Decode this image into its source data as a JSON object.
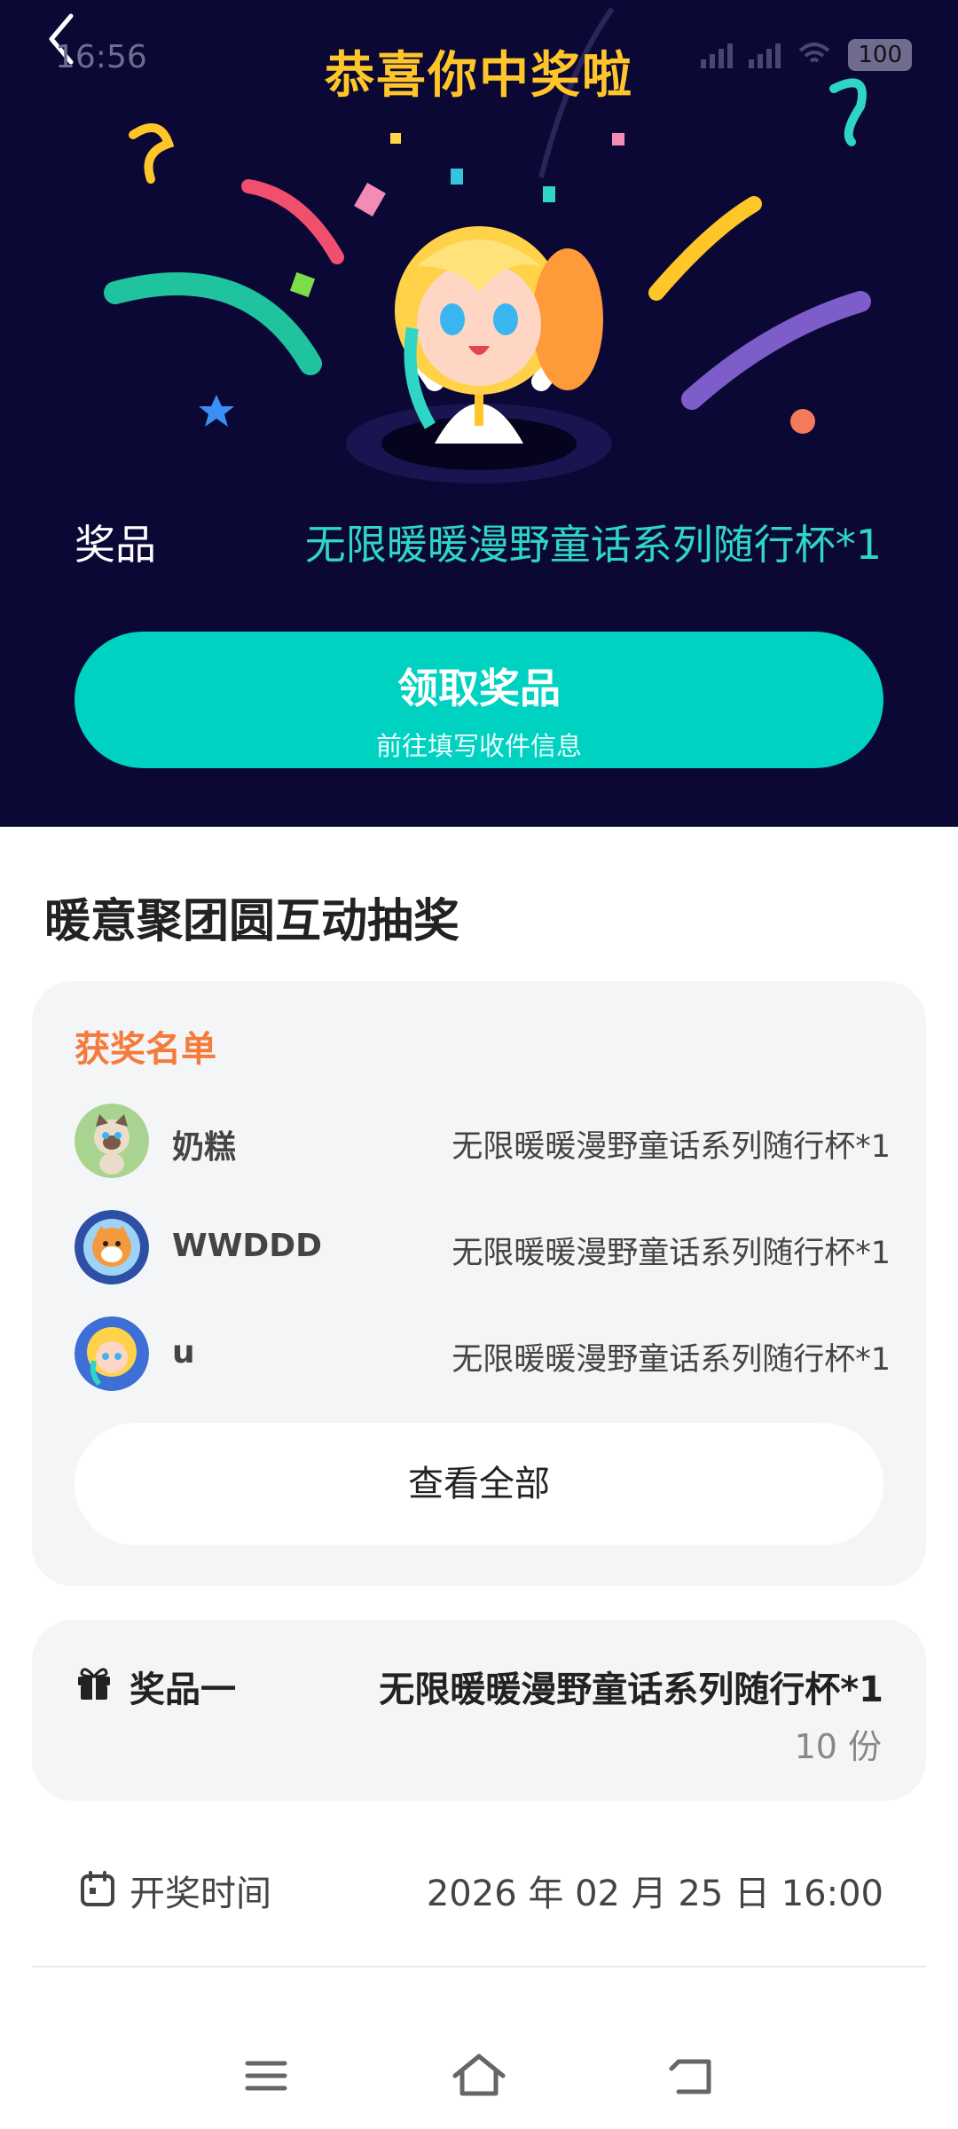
{
  "status": {
    "time": "16:56",
    "battery": "100"
  },
  "hero": {
    "title": "恭喜你中奖啦",
    "prize_label": "奖品",
    "prize_value": "无限暖暖漫野童话系列随行杯*1",
    "claim_button": {
      "label": "领取奖品",
      "sublabel": "前往填写收件信息"
    }
  },
  "event": {
    "title": "暖意聚团圆互动抽奖"
  },
  "winners": {
    "title": "获奖名单",
    "rows": [
      {
        "name": "奶糕",
        "prize": "无限暖暖漫野童话系列随行杯*1",
        "avatar": "cat-avatar"
      },
      {
        "name": "WWDDD",
        "prize": "无限暖暖漫野童话系列随行杯*1",
        "avatar": "shiba-avatar"
      },
      {
        "name": "u",
        "prize": "无限暖暖漫野童话系列随行杯*1",
        "avatar": "girl-avatar"
      }
    ],
    "view_all": "查看全部"
  },
  "prize_info": {
    "tier": "奖品一",
    "name": "无限暖暖漫野童话系列随行杯*1",
    "quantity": "10 份"
  },
  "draw": {
    "label": "开奖时间",
    "value": "2026 年 02 月 25 日 16:00"
  },
  "colors": {
    "hero_bg": "#0b0836",
    "accent": "#00d2c1",
    "title_yellow": "#ffc62a",
    "winners_orange": "#f57a3b"
  }
}
